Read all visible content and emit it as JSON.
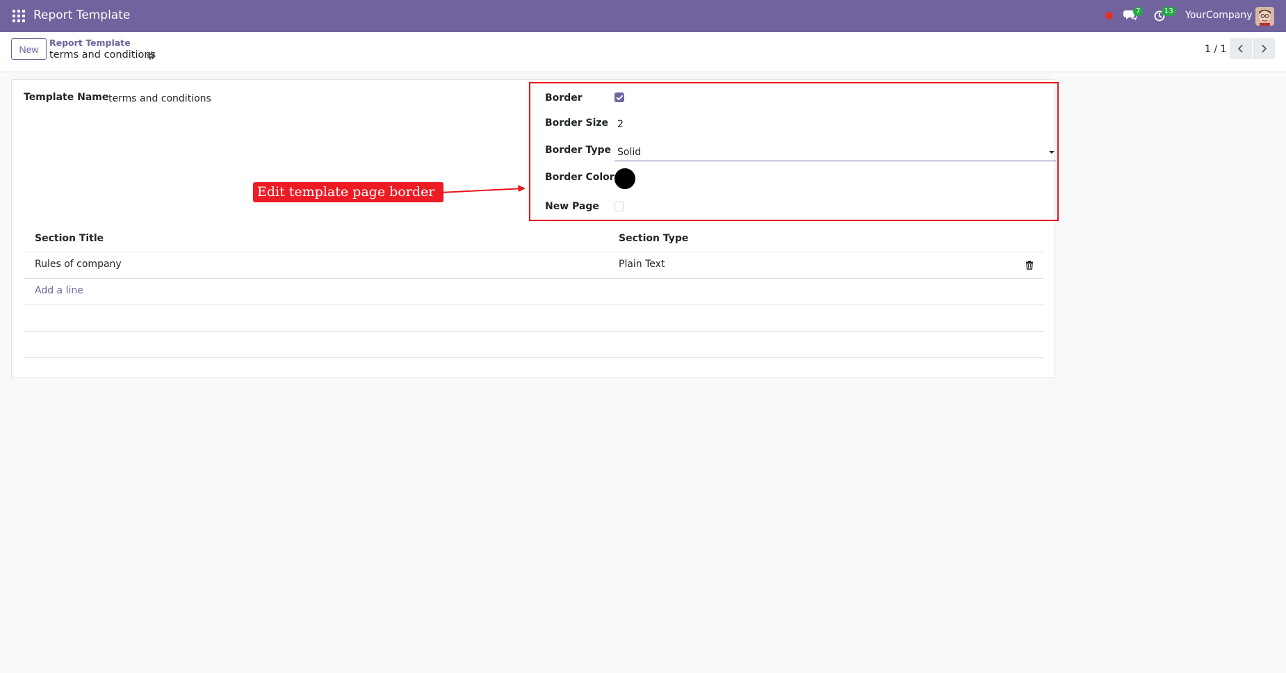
{
  "navbar": {
    "app_title": "Report Template",
    "chat_badge": "7",
    "activity_badge": "13",
    "company": "YourCompany",
    "bg_color": "#71639e"
  },
  "control_panel": {
    "new_label": "New",
    "breadcrumb_parent": "Report Template",
    "breadcrumb_current": "terms and conditions",
    "pager_value": "1 / 1"
  },
  "form": {
    "template_name_label": "Template Name",
    "template_name_value": "terms and conditions",
    "border_label": "Border",
    "border_checked": true,
    "border_size_label": "Border Size",
    "border_size_value": "2",
    "border_type_label": "Border Type",
    "border_type_value": "Solid",
    "border_color_label": "Border Color",
    "border_color_value": "#000000",
    "new_page_label": "New Page",
    "new_page_checked": false
  },
  "annotation": {
    "text": "Edit template page border",
    "color": "#ee1b24"
  },
  "table": {
    "headers": [
      "Section Title",
      "Section Type"
    ],
    "rows": [
      {
        "title": "Rules of company",
        "type": "Plain Text"
      }
    ],
    "add_line_label": "Add a line"
  }
}
